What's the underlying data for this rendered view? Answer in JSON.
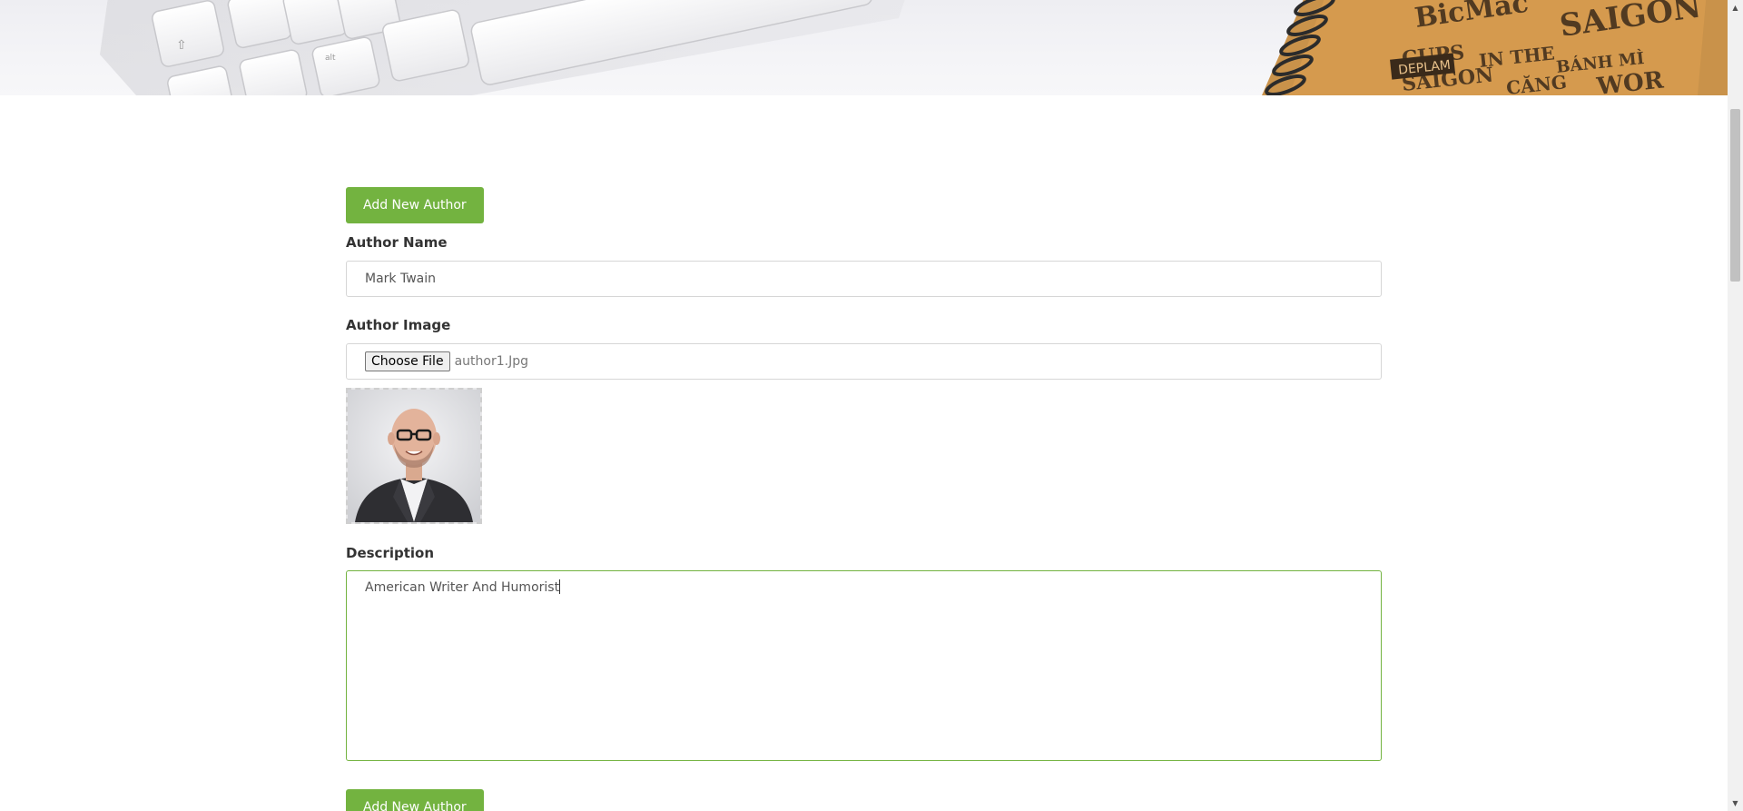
{
  "form": {
    "top_button_label": "Add New Author",
    "author_name_label": "Author Name",
    "author_name_value": "Mark Twain",
    "author_image_label": "Author Image",
    "choose_file_label": "Choose File",
    "file_name": "author1.Jpg",
    "description_label": "Description",
    "description_value": "American Writer And Humorist",
    "bottom_button_label": "Add New Author"
  },
  "colors": {
    "accent_green": "#73b340",
    "field_border": "#d6d6d6",
    "focused_border": "#73b340"
  },
  "icons": {
    "upload_preview": "author-photo",
    "scroll_up": "triangle-up-icon",
    "scroll_down": "triangle-down-icon"
  }
}
